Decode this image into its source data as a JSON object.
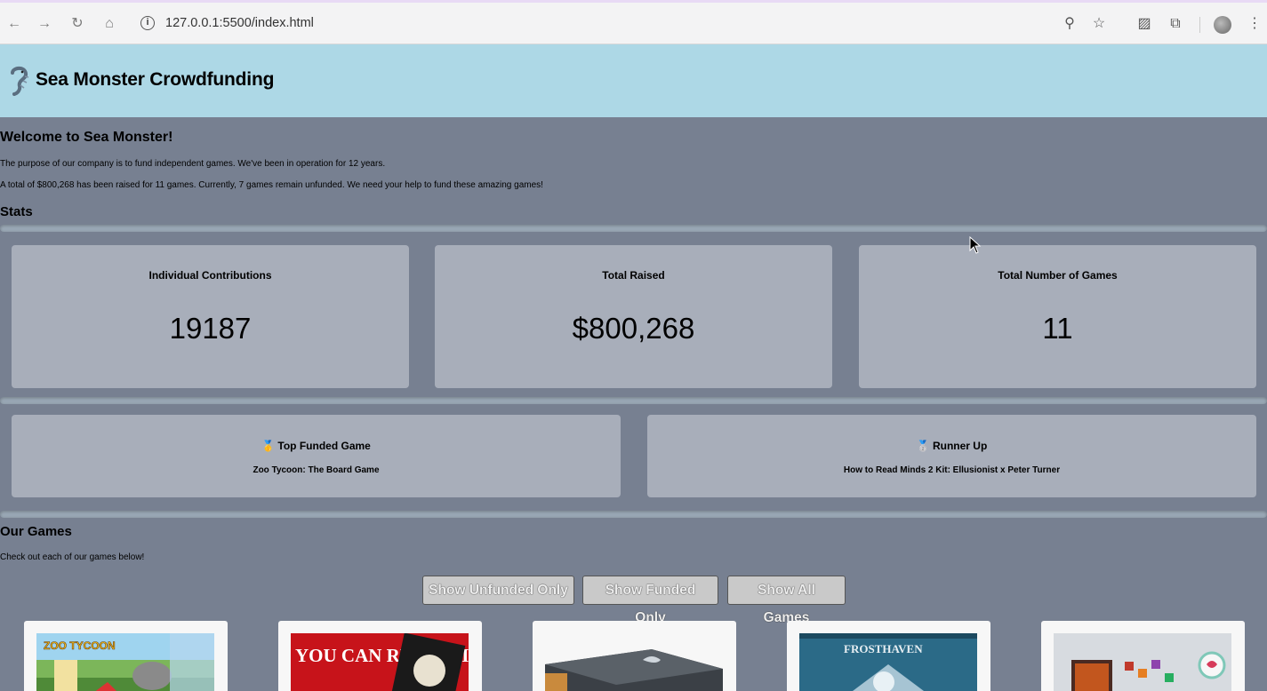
{
  "browser": {
    "url": "127.0.0.1:5500/index.html"
  },
  "header": {
    "title": "Sea Monster Crowdfunding"
  },
  "intro": {
    "heading": "Welcome to Sea Monster!",
    "paragraph1": "The purpose of our company is to fund independent games. We've been in operation for 12 years.",
    "paragraph2": "A total of $800,268 has been raised for 11 games. Currently, 7 games remain unfunded. We need your help to fund these amazing games!"
  },
  "stats": {
    "heading": "Stats",
    "cards": [
      {
        "label": "Individual Contributions",
        "value": "19187"
      },
      {
        "label": "Total Raised",
        "value": "$800,268"
      },
      {
        "label": "Total Number of Games",
        "value": "11"
      }
    ],
    "top_funded": {
      "label": "🥇 Top Funded Game",
      "game": "Zoo Tycoon: The Board Game"
    },
    "runner_up": {
      "label": "🥈 Runner Up",
      "game": "How to Read Minds 2 Kit: Ellusionist x Peter Turner"
    }
  },
  "games": {
    "heading": "Our Games",
    "description": "Check out each of our games below!",
    "buttons": [
      "Show Unfunded Only",
      "Show Funded Only",
      "Show All Games"
    ],
    "thumbnail_texts": {
      "read_minds": "YOU CAN READ MINDS",
      "frosthaven": "FROSTHAVEN",
      "zoo": "ZOO TYCOON"
    }
  },
  "colors": {
    "header_bg": "#add8e6",
    "page_bg": "#778091",
    "card_bg": "#a8aeba"
  }
}
